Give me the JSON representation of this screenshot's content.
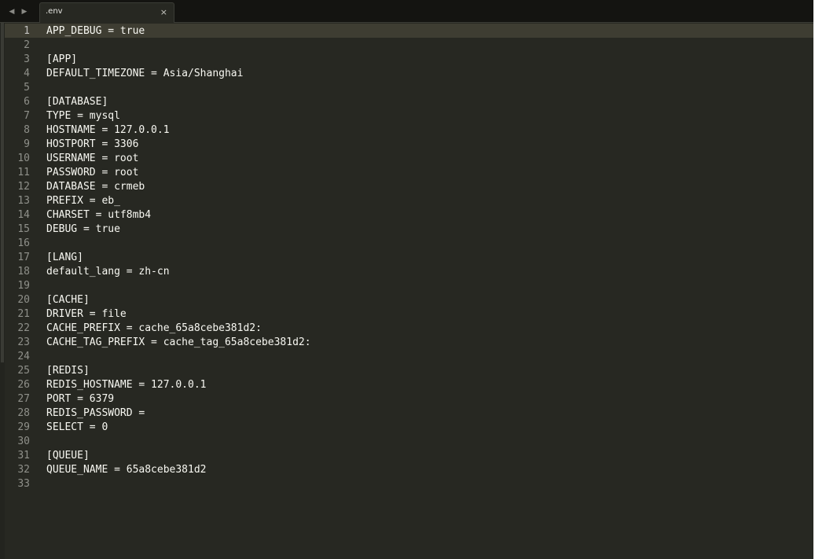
{
  "tab": {
    "title": ".env",
    "close_glyph": "×"
  },
  "nav": {
    "back_glyph": "◀",
    "forward_glyph": "▶"
  },
  "editor": {
    "active_line": 1,
    "lines": [
      {
        "n": "1",
        "text": "APP_DEBUG = true"
      },
      {
        "n": "2",
        "text": ""
      },
      {
        "n": "3",
        "text": "[APP]"
      },
      {
        "n": "4",
        "text": "DEFAULT_TIMEZONE = Asia/Shanghai"
      },
      {
        "n": "5",
        "text": ""
      },
      {
        "n": "6",
        "text": "[DATABASE]"
      },
      {
        "n": "7",
        "text": "TYPE = mysql"
      },
      {
        "n": "8",
        "text": "HOSTNAME = 127.0.0.1"
      },
      {
        "n": "9",
        "text": "HOSTPORT = 3306"
      },
      {
        "n": "10",
        "text": "USERNAME = root"
      },
      {
        "n": "11",
        "text": "PASSWORD = root"
      },
      {
        "n": "12",
        "text": "DATABASE = crmeb"
      },
      {
        "n": "13",
        "text": "PREFIX = eb_"
      },
      {
        "n": "14",
        "text": "CHARSET = utf8mb4"
      },
      {
        "n": "15",
        "text": "DEBUG = true"
      },
      {
        "n": "16",
        "text": ""
      },
      {
        "n": "17",
        "text": "[LANG]"
      },
      {
        "n": "18",
        "text": "default_lang = zh-cn"
      },
      {
        "n": "19",
        "text": ""
      },
      {
        "n": "20",
        "text": "[CACHE]"
      },
      {
        "n": "21",
        "text": "DRIVER = file"
      },
      {
        "n": "22",
        "text": "CACHE_PREFIX = cache_65a8cebe381d2:"
      },
      {
        "n": "23",
        "text": "CACHE_TAG_PREFIX = cache_tag_65a8cebe381d2:"
      },
      {
        "n": "24",
        "text": ""
      },
      {
        "n": "25",
        "text": "[REDIS]"
      },
      {
        "n": "26",
        "text": "REDIS_HOSTNAME = 127.0.0.1"
      },
      {
        "n": "27",
        "text": "PORT = 6379"
      },
      {
        "n": "28",
        "text": "REDIS_PASSWORD ="
      },
      {
        "n": "29",
        "text": "SELECT = 0"
      },
      {
        "n": "30",
        "text": ""
      },
      {
        "n": "31",
        "text": "[QUEUE]"
      },
      {
        "n": "32",
        "text": "QUEUE_NAME = 65a8cebe381d2"
      },
      {
        "n": "33",
        "text": ""
      }
    ]
  },
  "colors": {
    "background": "#272822",
    "text": "#f8f8f2",
    "gutter_text": "#8f908a",
    "active_line": "#3e3d32"
  }
}
